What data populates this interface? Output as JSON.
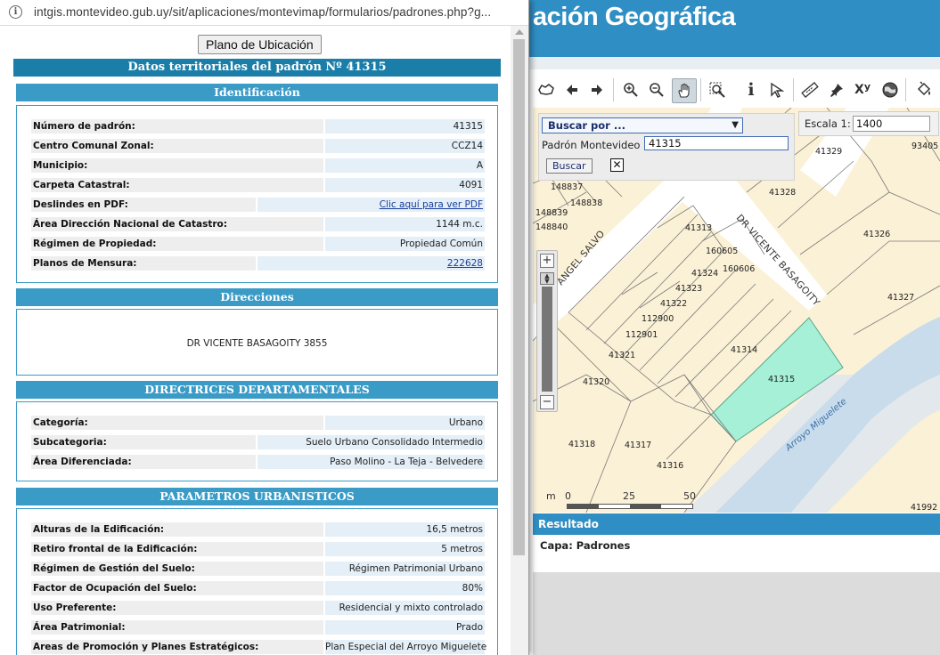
{
  "browser": {
    "url": "intgis.montevideo.gub.uy/sit/aplicaciones/montevimap/formularios/padrones.php?g..."
  },
  "popup": {
    "plano_button": "Plano de Ubicación",
    "title": "Datos territoriales del padrón Nº 41315",
    "identificacion": {
      "header": "Identificación",
      "rows": [
        {
          "label": "Número de padrón:",
          "value": "41315"
        },
        {
          "label": "Centro Comunal Zonal:",
          "value": "CCZ14"
        },
        {
          "label": "Municipio:",
          "value": "A"
        },
        {
          "label": "Carpeta Catastral:",
          "value": "4091"
        },
        {
          "label": "Deslindes en PDF:",
          "value": "Clic aquí para ver PDF"
        },
        {
          "label": "Área Dirección Nacional de Catastro:",
          "value": "1144 m.c."
        },
        {
          "label": "Régimen de Propiedad:",
          "value": "Propiedad Común"
        },
        {
          "label": "Planos de Mensura:",
          "value": "222628"
        }
      ]
    },
    "direcciones": {
      "header": "Direcciones",
      "address": "DR VICENTE BASAGOITY 3855"
    },
    "directrices": {
      "header": "DIRECTRICES DEPARTAMENTALES",
      "rows": [
        {
          "label": "Categoría:",
          "value": "Urbano"
        },
        {
          "label": "Subcategoria:",
          "value": "Suelo Urbano Consolidado Intermedio"
        },
        {
          "label": "Área Diferenciada:",
          "value": "Paso Molino - La Teja - Belvedere"
        }
      ]
    },
    "parametros": {
      "header": "PARAMETROS URBANISTICOS",
      "rows": [
        {
          "label": "Alturas de la Edificación:",
          "value": "16,5 metros"
        },
        {
          "label": "Retiro frontal de la Edificación:",
          "value": "5 metros"
        },
        {
          "label": "Régimen de Gestión del Suelo:",
          "value": "Régimen Patrimonial Urbano"
        },
        {
          "label": "Factor de Ocupación del Suelo:",
          "value": "80%"
        },
        {
          "label": "Uso Preferente:",
          "value": "Residencial y mixto controlado"
        },
        {
          "label": "Área Patrimonial:",
          "value": "Prado"
        },
        {
          "label": "Areas de Promoción y Planes Estratégicos:",
          "value": "Plan Especial del Arroyo Miguelete"
        }
      ]
    }
  },
  "app": {
    "title": "ación Geográfica",
    "toolbar_icons": [
      "extent-icon",
      "pan-left-icon",
      "pan-right-icon",
      "zoom-in-icon",
      "zoom-out-icon",
      "hand-pan-icon",
      "zoom-box-icon",
      "info-icon",
      "select-icon",
      "measure-icon",
      "pin-icon",
      "xy-coordinates-icon",
      "globe-icon",
      "paint-bucket-icon"
    ],
    "search": {
      "select_value": "Buscar por ...",
      "label": "Padrón Montevideo",
      "value": "41315",
      "button": "Buscar"
    },
    "scale": {
      "label": "Escala 1:",
      "value": "1400"
    },
    "map": {
      "lots": [
        "41329",
        "93405",
        "41328",
        "41326",
        "148837",
        "148838",
        "148839",
        "148840",
        "41313",
        "160605",
        "160606",
        "41324",
        "41323",
        "41322",
        "112900",
        "112901",
        "41321",
        "41327",
        "41314",
        "41315",
        "41320",
        "41318",
        "41317",
        "41316",
        "41992"
      ],
      "streets": [
        "DR VICENTE BASAGOITY",
        "ANGEL SALVO"
      ],
      "river": "Arroyo Miguelete",
      "highlight_color": "#a5f0d6"
    },
    "scalebar": {
      "unit": "m",
      "ticks": [
        "0",
        "25",
        "50"
      ]
    },
    "result": {
      "header": "Resultado",
      "text": "Capa: Padrones"
    }
  }
}
